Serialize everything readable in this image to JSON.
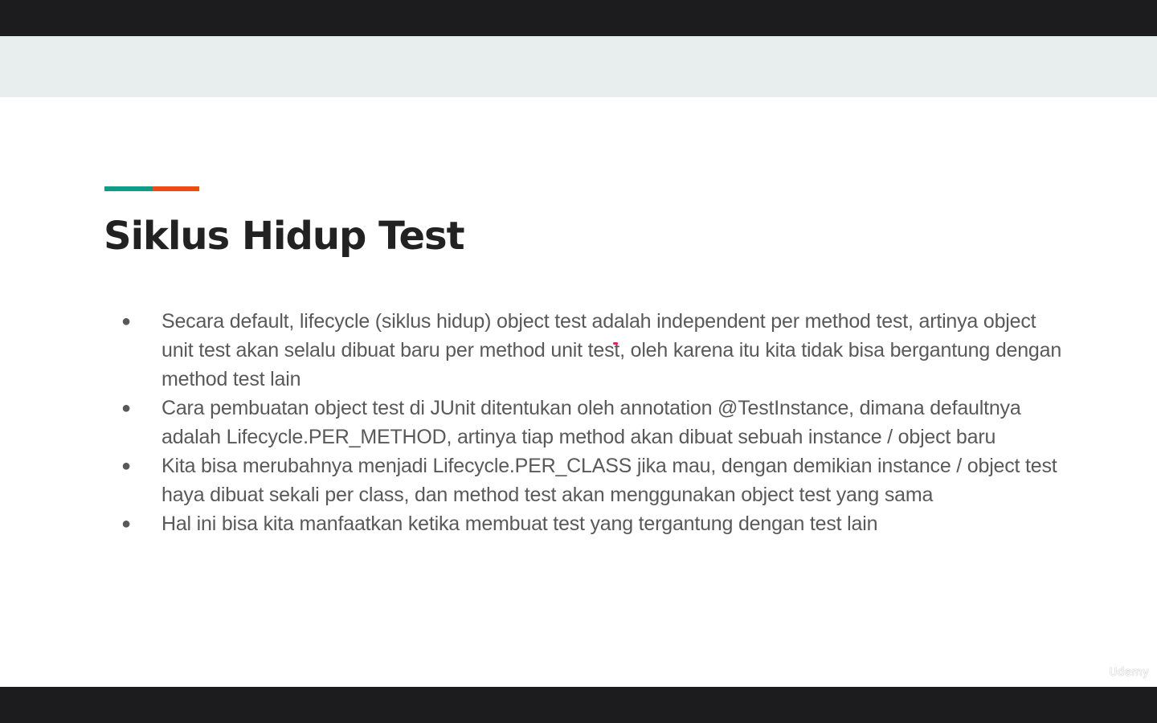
{
  "slide": {
    "title": "Siklus Hidup Test",
    "bullets": [
      "Secara default, lifecycle (siklus hidup) object test adalah independent per method test, artinya object unit test  akan selalu dibuat baru per method unit test, oleh karena itu kita tidak bisa bergantung dengan method test lain",
      "Cara pembuatan object test di JUnit ditentukan oleh annotation @TestInstance, dimana defaultnya adalah Lifecycle.PER_METHOD, artinya tiap method akan dibuat sebuah instance / object baru",
      "Kita bisa merubahnya menjadi Lifecycle.PER_CLASS jika mau, dengan demikian instance / object test haya dibuat sekali per class, dan method test akan menggunakan object test yang sama",
      "Hal ini bisa kita manfaatkan ketika membuat test yang tergantung dengan test lain"
    ],
    "bullet_glyph": "●",
    "watermark": "Udemy"
  },
  "colors": {
    "accent_teal": "#0f9d8a",
    "accent_orange": "#ee4c14",
    "title": "#222222",
    "body_text": "#595959",
    "letterbox": "#1c1c1e",
    "header_band": "#e8eded"
  }
}
